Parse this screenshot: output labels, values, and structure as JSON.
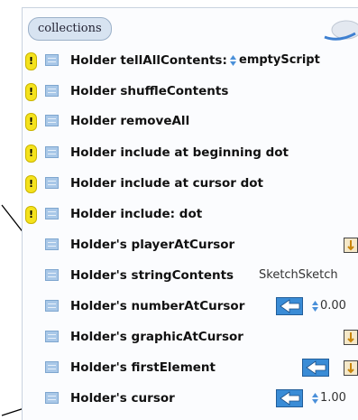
{
  "tab_label": "collections",
  "rows": [
    {
      "label": "Holder tellAllContents:",
      "value": "emptyScript",
      "warn": true
    },
    {
      "label": "Holder shuffleContents",
      "warn": true
    },
    {
      "label": "Holder removeAll",
      "warn": true
    },
    {
      "label": "Holder include at beginning dot",
      "warn": true
    },
    {
      "label": "Holder include at cursor dot",
      "warn": true
    },
    {
      "label": "Holder include: dot",
      "warn": true
    },
    {
      "label": "Holder's playerAtCursor",
      "warn": false
    },
    {
      "label": "Holder's stringContents",
      "value": "SketchSketch",
      "warn": false
    },
    {
      "label": "Holder's numberAtCursor",
      "value": "0.00",
      "warn": false
    },
    {
      "label": "Holder's graphicAtCursor",
      "warn": false
    },
    {
      "label": "Holder's firstElement",
      "warn": false
    },
    {
      "label": "Holder's cursor",
      "value": "1.00",
      "warn": false
    }
  ],
  "warning_glyph": "!",
  "icons": {
    "warning": "exclamation-badge-icon",
    "tile": "tile-icon",
    "player": "player-thumbnail-icon",
    "arrow": "left-arrow-icon",
    "spinner": "up-down-spinner-icon",
    "cloud": "cloud-icon"
  },
  "colors": {
    "warning": "#f4e21d",
    "tile": "#a9c8e8",
    "arrow_box": "#3a8cd6",
    "tab": "#d7e3f1"
  }
}
